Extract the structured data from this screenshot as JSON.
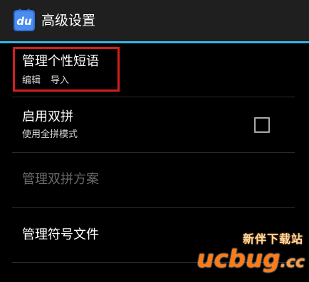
{
  "action_bar": {
    "icon": "du-keyboard-app-icon",
    "icon_text": "du",
    "title": "高级设置",
    "accent_color": "#33b5e5"
  },
  "preferences": [
    {
      "title": "管理个性短语",
      "summary_parts": [
        "编辑",
        "导入"
      ],
      "enabled": true,
      "highlighted": true
    },
    {
      "title": "启用双拼",
      "summary": "使用全拼模式",
      "enabled": true,
      "checkbox_checked": false
    },
    {
      "title": "管理双拼方案",
      "enabled": false
    },
    {
      "title": "管理符号文件",
      "enabled": true
    }
  ],
  "watermark": {
    "chinese": "新伴下载站",
    "logo": "ucbug",
    "logo_suffix": ".cc"
  },
  "colors": {
    "highlight_border": "#d41e1e",
    "background": "#000000",
    "disabled_text": "#6a6a6a"
  }
}
